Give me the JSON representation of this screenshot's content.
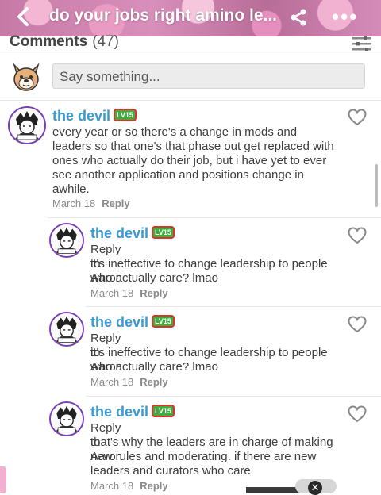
{
  "header": {
    "back_icon": "chevron-left-icon",
    "title": "do your jobs right amino le...",
    "share_icon": "share-icon",
    "more_icon": "more-dots-icon",
    "more_glyph": "•••"
  },
  "comments_section": {
    "label": "Comments",
    "count": "(47)",
    "filter_icon": "filter-icon"
  },
  "compose": {
    "placeholder": "Say something..."
  },
  "level_badge": "LV15",
  "comments": [
    {
      "username": "the devil",
      "text": "every year or so there's a change in mods and leaders so that one's that phase out get replaced with ones who actually do their job, but i have yet to ever see another application and positions change in awhile.",
      "date": "March 18",
      "reply_label": "Reply"
    },
    {
      "username": "the devil",
      "reply_to": "Reply to: Aaron",
      "text": "it's ineffective to change leadership to people who actually care? lmao",
      "date": "March 18",
      "reply_label": "Reply"
    },
    {
      "username": "the devil",
      "reply_to": "Reply to: Aaron",
      "text": "it's ineffective to change leadership to people who actually care? lmao",
      "date": "March 18",
      "reply_label": "Reply"
    },
    {
      "username": "the devil",
      "reply_to": "Reply to: Aaron",
      "text": "that's why the leaders are in charge of making new rules and moderating. if there are new leaders and curators who care",
      "date": "March 18",
      "reply_label": "Reply"
    }
  ],
  "colors": {
    "username": "#3a9ad1",
    "avatar_ring": "#7a3fb5",
    "header_pink": "#d98fbb"
  }
}
